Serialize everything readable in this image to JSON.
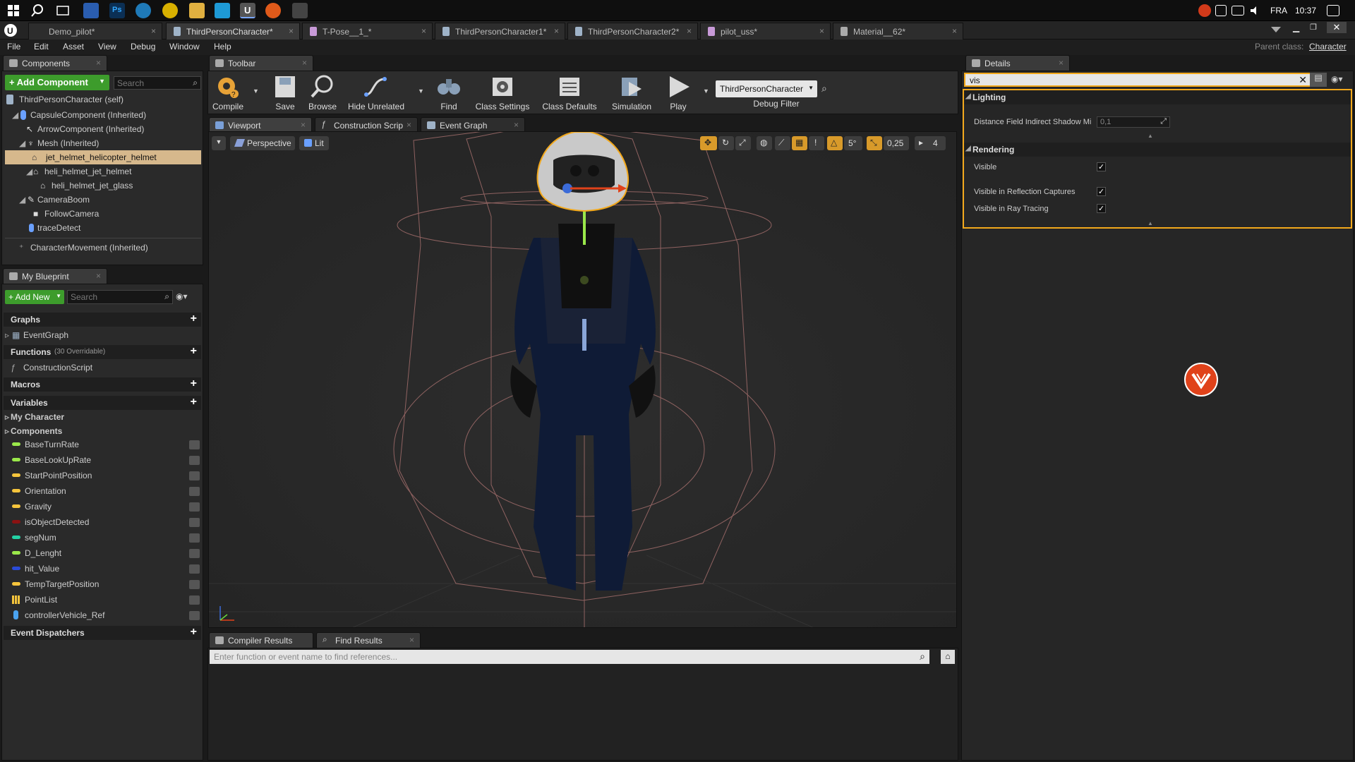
{
  "taskbar": {
    "lang": "FRA",
    "time": "10:37"
  },
  "doc_tabs": [
    {
      "label": "Demo_pilot*"
    },
    {
      "label": "ThirdPersonCharacter*"
    },
    {
      "label": "T-Pose__1_*"
    },
    {
      "label": "ThirdPersonCharacter1*"
    },
    {
      "label": "ThirdPersonCharacter2*"
    },
    {
      "label": "pilot_uss*"
    },
    {
      "label": "Material__62*"
    }
  ],
  "menu": [
    "File",
    "Edit",
    "Asset",
    "View",
    "Debug",
    "Window",
    "Help"
  ],
  "parent_class": {
    "label": "Parent class:",
    "value": "Character"
  },
  "components": {
    "tab": "Components",
    "add_button": "+ Add Component",
    "search_placeholder": "Search",
    "self": "ThirdPersonCharacter (self)",
    "items": [
      "CapsuleComponent (Inherited)",
      "ArrowComponent (Inherited)",
      "Mesh (Inherited)",
      "jet_helmet_helicopter_helmet",
      "heli_helmet_jet_helmet",
      "heli_helmet_jet_glass",
      "CameraBoom",
      "FollowCamera",
      "traceDetect",
      "CharacterMovement (Inherited)"
    ]
  },
  "my_blueprint": {
    "tab": "My Blueprint",
    "add_new": "+ Add New",
    "search_placeholder": "Search",
    "graphs": "Graphs",
    "event_graph": "EventGraph",
    "functions": "Functions",
    "functions_note": "(30 Overridable)",
    "construction_script": "ConstructionScript",
    "macros": "Macros",
    "variables": "Variables",
    "my_character": "My Character",
    "components_cat": "Components",
    "vars": [
      {
        "name": "BaseTurnRate",
        "color": "#9ae84a"
      },
      {
        "name": "BaseLookUpRate",
        "color": "#9ae84a"
      },
      {
        "name": "StartPointPosition",
        "color": "#f5c43c"
      },
      {
        "name": "Orientation",
        "color": "#f5c43c"
      },
      {
        "name": "Gravity",
        "color": "#f5c43c"
      },
      {
        "name": "isObjectDetected",
        "color": "#8b1212"
      },
      {
        "name": "segNum",
        "color": "#23d1a4"
      },
      {
        "name": "D_Lenght",
        "color": "#9ae84a"
      },
      {
        "name": "hit_Value",
        "color": "#2a4bd8"
      },
      {
        "name": "TempTargetPosition",
        "color": "#f5c43c"
      },
      {
        "name": "PointList",
        "color": "#f5c43c"
      },
      {
        "name": "controllerVehicle_Ref",
        "color": "#4aa3f0"
      }
    ],
    "event_dispatchers": "Event Dispatchers"
  },
  "toolbar": {
    "tab": "Toolbar",
    "buttons": [
      "Compile",
      "Save",
      "Browse",
      "Hide Unrelated",
      "Find",
      "Class Settings",
      "Class Defaults",
      "Simulation",
      "Play"
    ],
    "debug_object": "ThirdPersonCharacter",
    "debug_filter": "Debug Filter"
  },
  "editor_tabs": [
    "Viewport",
    "Construction Scrip",
    "Event Graph"
  ],
  "viewport": {
    "perspective": "Perspective",
    "lit": "Lit",
    "angle_snap": "5°",
    "scale_snap": "0,25",
    "camera_speed": "4"
  },
  "bottom_tabs": [
    "Compiler Results",
    "Find Results"
  ],
  "find_placeholder": "Enter function or event name to find references...",
  "details": {
    "tab": "Details",
    "search_value": "vis",
    "lighting": "Lighting",
    "dist_field_label": "Distance Field Indirect Shadow Mi",
    "dist_field_value": "0,1",
    "rendering": "Rendering",
    "visible": "Visible",
    "visible_reflection": "Visible in Reflection Captures",
    "visible_raytracing": "Visible in Ray Tracing"
  }
}
